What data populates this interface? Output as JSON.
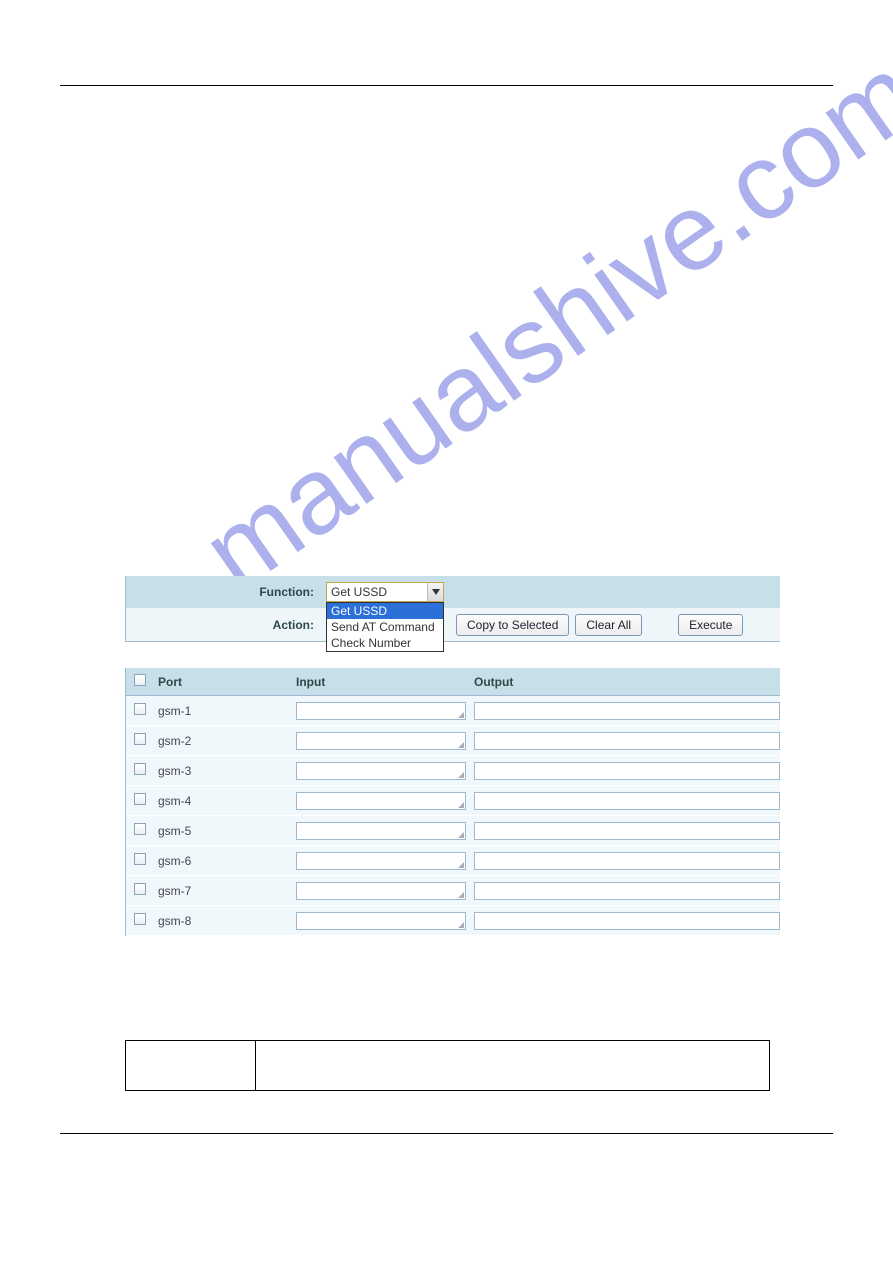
{
  "watermark": "manualshive.com",
  "controls": {
    "function_label": "Function:",
    "action_label": "Action:",
    "select_current": "Get USSD",
    "options": [
      {
        "label": "Get USSD",
        "selected": true
      },
      {
        "label": "Send AT Command",
        "selected": false
      },
      {
        "label": "Check Number",
        "selected": false
      }
    ],
    "copy_btn": "Copy to Selected",
    "clear_btn": "Clear All",
    "exec_btn": "Execute"
  },
  "headers": {
    "port": "Port",
    "input": "Input",
    "output": "Output"
  },
  "rows": [
    {
      "port": "gsm-1"
    },
    {
      "port": "gsm-2"
    },
    {
      "port": "gsm-3"
    },
    {
      "port": "gsm-4"
    },
    {
      "port": "gsm-5"
    },
    {
      "port": "gsm-6"
    },
    {
      "port": "gsm-7"
    },
    {
      "port": "gsm-8"
    }
  ]
}
